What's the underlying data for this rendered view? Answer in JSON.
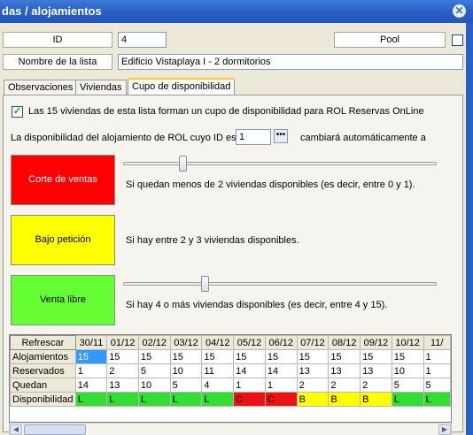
{
  "window": {
    "title": "das / alojamientos",
    "close_icon": "close-icon"
  },
  "form": {
    "id_label": "ID",
    "id_value": "4",
    "pool_label": "Pool",
    "name_label": "Nombre de la lista",
    "name_value": "Edificio Vistaplaya I -  2 dormitorios"
  },
  "tabs": [
    {
      "label": "Observaciones"
    },
    {
      "label": "Viviendas"
    },
    {
      "label": "Cupo de disponibilidad"
    }
  ],
  "panel": {
    "cupo_checkbox_label": "Las 15 viviendas de esta lista forman un cupo de disponibilidad para ROL Reservas OnLine",
    "disponibilidad_prefix": "La disponibilidad del alojamiento de ROL cuyo ID es",
    "rol_id_value": "1",
    "disponibilidad_suffix": "cambiará automáticamente a",
    "states": [
      {
        "label": "Corte de ventas",
        "color": "#ff0000",
        "text_color": "#ffffff",
        "description": "Si quedan menos de 2 viviendas disponibles (es decir, entre 0 y 1).",
        "slider_level": 0.19
      },
      {
        "label": "Bajo petición",
        "color": "#ffff00",
        "text_color": "#000000",
        "description": "Si hay entre 2 y 3 viviendas disponibles."
      },
      {
        "label": "Venta libre",
        "color": "#66ff33",
        "text_color": "#000000",
        "description": "Si hay 4 o más viviendas disponibles (es decir, entre 4 y 15).",
        "slider_level": 0.26
      }
    ]
  },
  "grid": {
    "refresh_label": "Refrescar",
    "dates": [
      "30/11",
      "01/12",
      "02/12",
      "03/12",
      "04/12",
      "05/12",
      "06/12",
      "07/12",
      "08/12",
      "09/12",
      "10/12",
      "11/"
    ],
    "rows": [
      {
        "label": "Alojamientos",
        "values": [
          "15",
          "15",
          "15",
          "15",
          "15",
          "15",
          "15",
          "15",
          "15",
          "15",
          "15",
          "1"
        ]
      },
      {
        "label": "Reservados",
        "values": [
          "1",
          "2",
          "5",
          "10",
          "11",
          "14",
          "14",
          "13",
          "13",
          "13",
          "10",
          "1"
        ]
      },
      {
        "label": "Quedan",
        "values": [
          "14",
          "13",
          "10",
          "5",
          "4",
          "1",
          "1",
          "2",
          "2",
          "2",
          "5",
          "5"
        ]
      },
      {
        "label": "Disponibilidad",
        "values": [
          "L",
          "L",
          "L",
          "L",
          "L",
          "C",
          "C",
          "B",
          "B",
          "B",
          "L",
          "L"
        ]
      }
    ],
    "status_colors": {
      "L": "#33dd33",
      "C": "#ee1111",
      "B": "#ffff00"
    }
  }
}
